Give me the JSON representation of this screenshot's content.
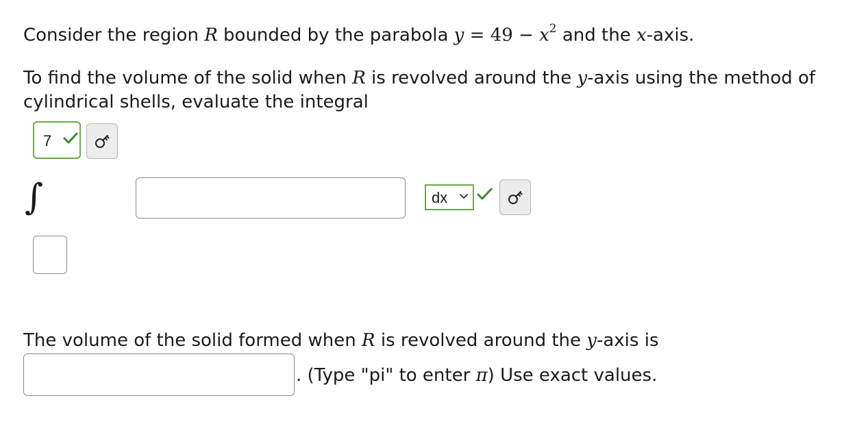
{
  "question": {
    "line1": {
      "t1": "Consider the region ",
      "region_var": "R",
      "t2": " bounded by the parabola ",
      "eq_y": "y",
      "eq_eq": " = 49 − ",
      "eq_x": "x",
      "eq_exp": "2",
      "t3": " and the ",
      "axis_var": "x",
      "t4": "-axis."
    },
    "line2": {
      "t1": "To find the volume of the solid when ",
      "region_var": "R",
      "t2": " is revolved around the ",
      "axis_var": "y",
      "t3": "-axis using the method of"
    },
    "line3": "cylindrical shells, evaluate the integral"
  },
  "integral": {
    "symbol": "∫",
    "upper_limit_value": "7",
    "upper_limit_status": "correct",
    "lower_limit_value": "",
    "integrand_value": "",
    "differential_selected": "dx",
    "differential_status": "correct"
  },
  "volume": {
    "t1": "The volume of the solid formed when ",
    "region_var": "R",
    "t2": " is revolved around the ",
    "axis_var": "y",
    "t3": "-axis is",
    "answer_value": "",
    "hint_prefix": ". (Type \"pi\" to enter ",
    "hint_pi": "π",
    "hint_suffix": ") Use exact values."
  },
  "icons": {
    "check": "check-icon",
    "key": "key-icon",
    "chevron": "chevron-down-icon"
  },
  "colors": {
    "correct_green": "#6aa84f",
    "check_green": "#3a8a2a",
    "text": "#1a1a1a",
    "input_border": "#8a8a8a",
    "key_button_bg": "#ececec"
  }
}
